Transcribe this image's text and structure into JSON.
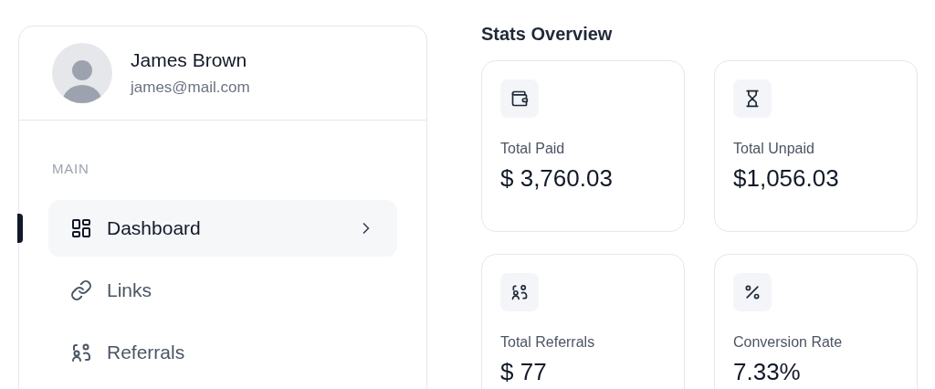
{
  "profile": {
    "name": "James Brown",
    "email": "james@mail.com"
  },
  "sidebar": {
    "section": "MAIN",
    "items": [
      {
        "label": "Dashboard",
        "selected": true
      },
      {
        "label": "Links",
        "selected": false
      },
      {
        "label": "Referrals",
        "selected": false
      }
    ]
  },
  "stats": {
    "title": "Stats Overview",
    "cards": [
      {
        "label": "Total Paid",
        "value": "$ 3,760.03"
      },
      {
        "label": "Total Unpaid",
        "value": "$1,056.03"
      },
      {
        "label": "Total Referrals",
        "value": "$ 77"
      },
      {
        "label": "Conversion Rate",
        "value": "7.33%"
      }
    ]
  }
}
